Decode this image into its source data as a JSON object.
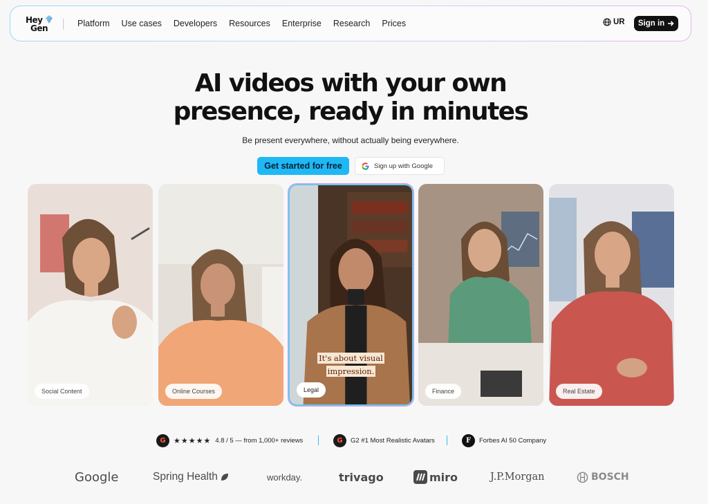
{
  "nav": {
    "logo_line1": "Hey",
    "logo_line2": "Gen",
    "links": [
      "Platform",
      "Use cases",
      "Developers",
      "Resources",
      "Enterprise",
      "Research",
      "Prices"
    ],
    "lang_label": "UR",
    "signin_label": "Sign in"
  },
  "hero": {
    "headline_line1": "AI videos with your own",
    "headline_line2": "presence, ready in minutes",
    "subheadline": "Be present everywhere, without actually being everywhere.",
    "cta_label": "Get started for free",
    "google_label": "Sign up with Google"
  },
  "cards": [
    {
      "label": "Social Content"
    },
    {
      "label": "Online Courses"
    },
    {
      "label": "Legal",
      "caption_line1": "It's about visual",
      "caption_line2": "impression."
    },
    {
      "label": "Finance"
    },
    {
      "label": "Real Estate"
    }
  ],
  "proof": {
    "rating": "4.8 / 5 — from 1,000+ reviews",
    "stars": "★★★★★",
    "g2_award": "G2 #1 Most Realistic Avatars",
    "forbes": "Forbes AI 50 Company"
  },
  "logos": [
    "Google",
    "Spring Health",
    "workday.",
    "trivago",
    "miro",
    "J.P.Morgan",
    "BOSCH"
  ],
  "colors": {
    "accent": "#1fb8f5",
    "dark": "#111111"
  }
}
